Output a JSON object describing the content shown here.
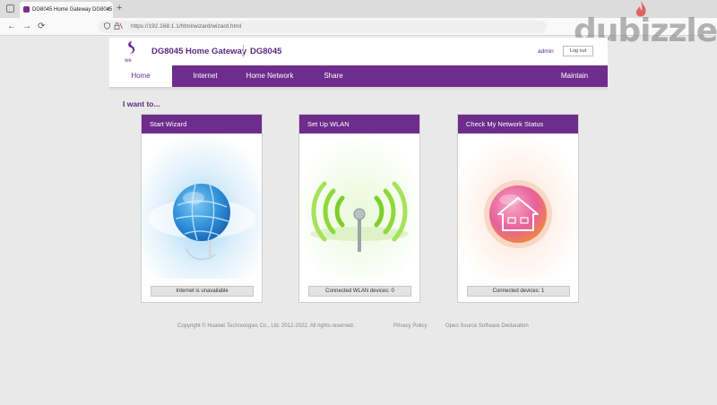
{
  "browser": {
    "tab_title": "DG8045 Home Gateway DG8045",
    "tab_close": "×",
    "new_tab": "+",
    "back": "←",
    "forward": "→",
    "reload": "⟳",
    "url": "https://192.168.1.1/html/wizard/wizard.html"
  },
  "header": {
    "product_title": "DG8045 Home Gateway",
    "model": "DG8045",
    "user": "admin",
    "logout_label": "Log out"
  },
  "nav": {
    "items": [
      {
        "label": "Home"
      },
      {
        "label": "Internet"
      },
      {
        "label": "Home Network"
      },
      {
        "label": "Share"
      },
      {
        "label": "Maintain"
      }
    ]
  },
  "main": {
    "heading": "I want to...",
    "cards": [
      {
        "title": "Start Wizard",
        "status": "Internet is unavailable",
        "icon": "globe-icon"
      },
      {
        "title": "Set Up WLAN",
        "status": "Connected WLAN devices: 0",
        "icon": "wifi-antenna-icon"
      },
      {
        "title": "Check My Network Status",
        "status": "Connected devices: 1",
        "icon": "home-network-icon"
      }
    ]
  },
  "footer": {
    "copyright": "Copyright © Huawei Technologies Co., Ltd. 2012-2022. All rights reserved.",
    "privacy": "Privacy Policy",
    "open_source": "Open Source Software Declaration"
  },
  "watermark": {
    "text": "dubizzle"
  },
  "colors": {
    "brand_purple": "#6e2c8d",
    "title_purple": "#5b2a82",
    "background": "#e9e9e9"
  }
}
